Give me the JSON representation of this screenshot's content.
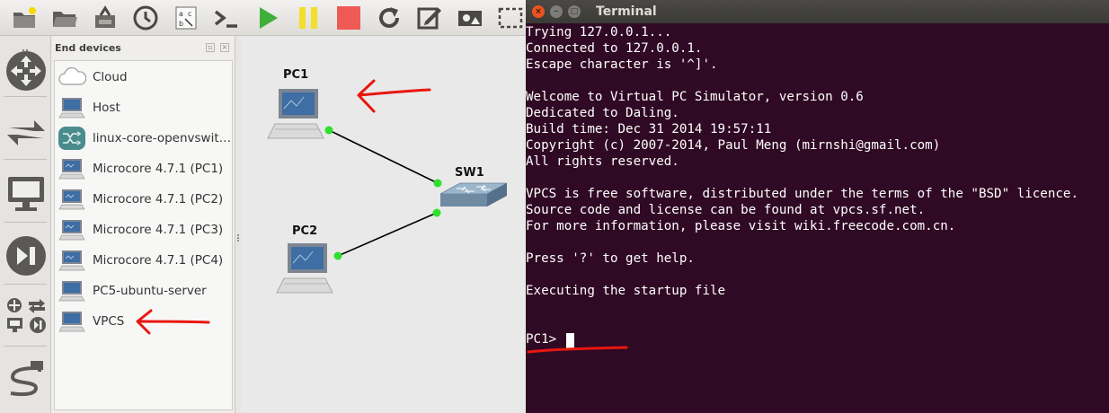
{
  "toolbar": {
    "buttons": [
      "new-project-icon",
      "open-project-icon",
      "save-snapshot-icon",
      "clock-icon",
      "text-editor-icon",
      "console-icon",
      "start-icon",
      "pause-icon",
      "stop-icon",
      "reload-icon",
      "annotate-icon",
      "screenshot-icon",
      "select-rect-icon"
    ]
  },
  "dock": {
    "title": "End devices",
    "items": [
      {
        "label": "Cloud",
        "icon": "cloud-icon"
      },
      {
        "label": "Host",
        "icon": "host-icon"
      },
      {
        "label": "linux-core-openvswit…",
        "icon": "switch-router-icon"
      },
      {
        "label": "Microcore 4.7.1 (PC1)",
        "icon": "pc-icon"
      },
      {
        "label": "Microcore 4.7.1 (PC2)",
        "icon": "pc-icon"
      },
      {
        "label": "Microcore 4.7.1 (PC3)",
        "icon": "pc-icon"
      },
      {
        "label": "Microcore 4.7.1 (PC4)",
        "icon": "pc-icon"
      },
      {
        "label": "PC5-ubuntu-server",
        "icon": "pc-icon"
      },
      {
        "label": "VPCS",
        "icon": "pc-icon"
      }
    ]
  },
  "canvas": {
    "nodes": {
      "pc1": "PC1",
      "pc2": "PC2",
      "sw1": "SW1"
    },
    "link_color": "#000000",
    "port_up_color": "#22dd22"
  },
  "terminal": {
    "title": "Terminal",
    "lines": [
      "Trying 127.0.0.1...",
      "Connected to 127.0.0.1.",
      "Escape character is '^]'.",
      "",
      "Welcome to Virtual PC Simulator, version 0.6",
      "Dedicated to Daling.",
      "Build time: Dec 31 2014 19:57:11",
      "Copyright (c) 2007-2014, Paul Meng (mirnshi@gmail.com)",
      "All rights reserved.",
      "",
      "VPCS is free software, distributed under the terms of the \"BSD\" licence.",
      "Source code and license can be found at vpcs.sf.net.",
      "For more information, please visit wiki.freecode.com.cn.",
      "",
      "Press '?' to get help.",
      "",
      "Executing the startup file",
      "",
      "",
      "PC1> "
    ],
    "background": "#300a24",
    "foreground": "#ffffff"
  },
  "annotation_color": "#e8170f"
}
